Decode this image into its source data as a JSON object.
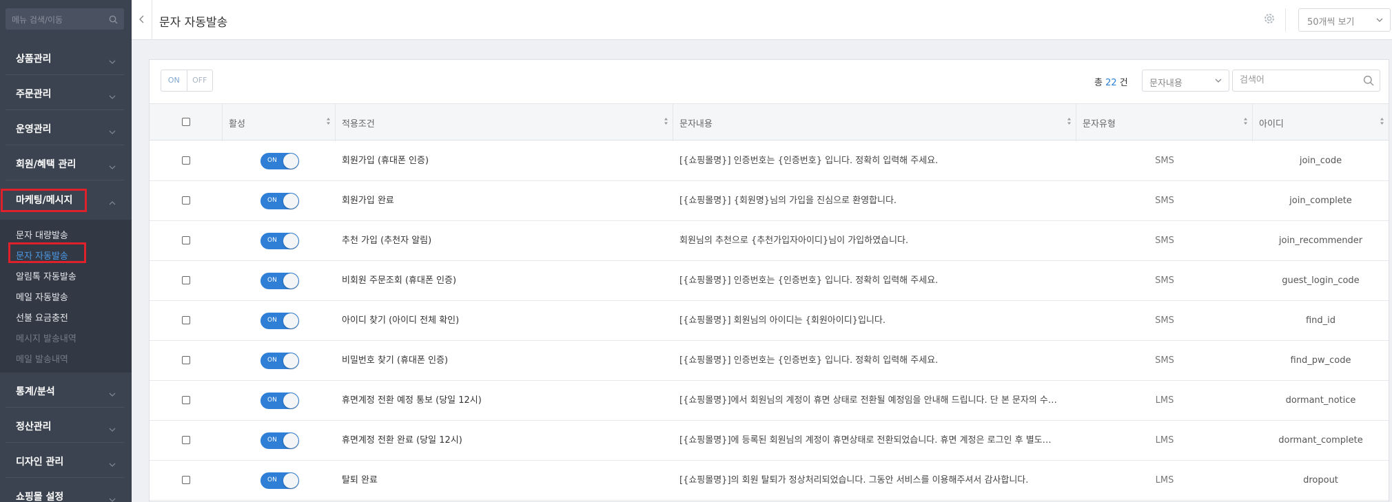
{
  "sidebar": {
    "search_placeholder": "메뉴 검색/이동",
    "menus": [
      {
        "label": "상품관리"
      },
      {
        "label": "주문관리"
      },
      {
        "label": "운영관리"
      },
      {
        "label": "회원/혜택 관리"
      },
      {
        "label": "마케팅/메시지"
      },
      {
        "label": "통계/분석"
      },
      {
        "label": "정산관리"
      },
      {
        "label": "디자인 관리"
      },
      {
        "label": "쇼핑몰 설정"
      }
    ],
    "submenu": [
      {
        "label": "문자 대량발송"
      },
      {
        "label": "문자 자동발송"
      },
      {
        "label": "알림톡 자동발송"
      },
      {
        "label": "메일 자동발송"
      },
      {
        "label": "선불 요금충전"
      },
      {
        "label": "메시지 발송내역"
      },
      {
        "label": "메일 발송내역"
      }
    ]
  },
  "header": {
    "title": "문자 자동발송",
    "per_page": "50개씩 보기"
  },
  "toolbar": {
    "on_label": "ON",
    "off_label": "OFF",
    "total_prefix": "총",
    "total_count": "22",
    "total_suffix": "건",
    "search_field": "문자내용",
    "search_placeholder": "검색어"
  },
  "table": {
    "columns": [
      {
        "label": "활성"
      },
      {
        "label": "적용조건"
      },
      {
        "label": "문자내용"
      },
      {
        "label": "문자유형"
      },
      {
        "label": "아이디"
      }
    ],
    "switch_label": "ON",
    "rows": [
      {
        "condition": "회원가입 (휴대폰 인증)",
        "content": "[{쇼핑몰명}] 인증번호는 {인증번호} 입니다. 정확히 입력해 주세요.",
        "type": "SMS",
        "id": "join_code",
        "active": true
      },
      {
        "condition": "회원가입 완료",
        "content": "[{쇼핑몰명}] {회원명}님의 가입을 진심으로 환영합니다.",
        "type": "SMS",
        "id": "join_complete",
        "active": true
      },
      {
        "condition": "추천 가입 (추천자 알림)",
        "content": "회원님의 추천으로 {추천가입자아이디}님이 가입하였습니다.",
        "type": "SMS",
        "id": "join_recommender",
        "active": true
      },
      {
        "condition": "비회원 주문조회 (휴대폰 인증)",
        "content": "[{쇼핑몰명}] 인증번호는 {인증번호} 입니다. 정확히 입력해 주세요.",
        "type": "SMS",
        "id": "guest_login_code",
        "active": true
      },
      {
        "condition": "아이디 찾기 (아이디 전체 확인)",
        "content": "[{쇼핑몰명}] 회원님의 아이디는 {회원아이디}입니다.",
        "type": "SMS",
        "id": "find_id",
        "active": true
      },
      {
        "condition": "비밀번호 찾기 (휴대폰 인증)",
        "content": "[{쇼핑몰명}] 인증번호는 {인증번호} 입니다. 정확히 입력해 주세요.",
        "type": "SMS",
        "id": "find_pw_code",
        "active": true
      },
      {
        "condition": "휴면계정 전환 예정 통보 (당일 12시)",
        "content": "[{쇼핑몰명}]에서 회원님의 계정이 휴면 상태로 전환될 예정임을 안내해 드립니다. 단 본 문자의 수…",
        "type": "LMS",
        "id": "dormant_notice",
        "active": true
      },
      {
        "condition": "휴면계정 전환 완료 (당일 12시)",
        "content": "[{쇼핑몰명}]에 등록된 회원님의 계정이 휴면상태로 전환되었습니다. 휴면 계정은 로그인 후 별도…",
        "type": "LMS",
        "id": "dormant_complete",
        "active": true
      },
      {
        "condition": "탈퇴 완료",
        "content": "[{쇼핑몰명}]의 회원 탈퇴가 정상처리되었습니다. 그동안 서비스를 이용해주셔서 감사합니다.",
        "type": "LMS",
        "id": "dropout",
        "active": true
      }
    ]
  },
  "colors": {
    "sidebar_bg": "#3c4350",
    "accent": "#2f7fd6",
    "highlight": "#e0202a"
  }
}
